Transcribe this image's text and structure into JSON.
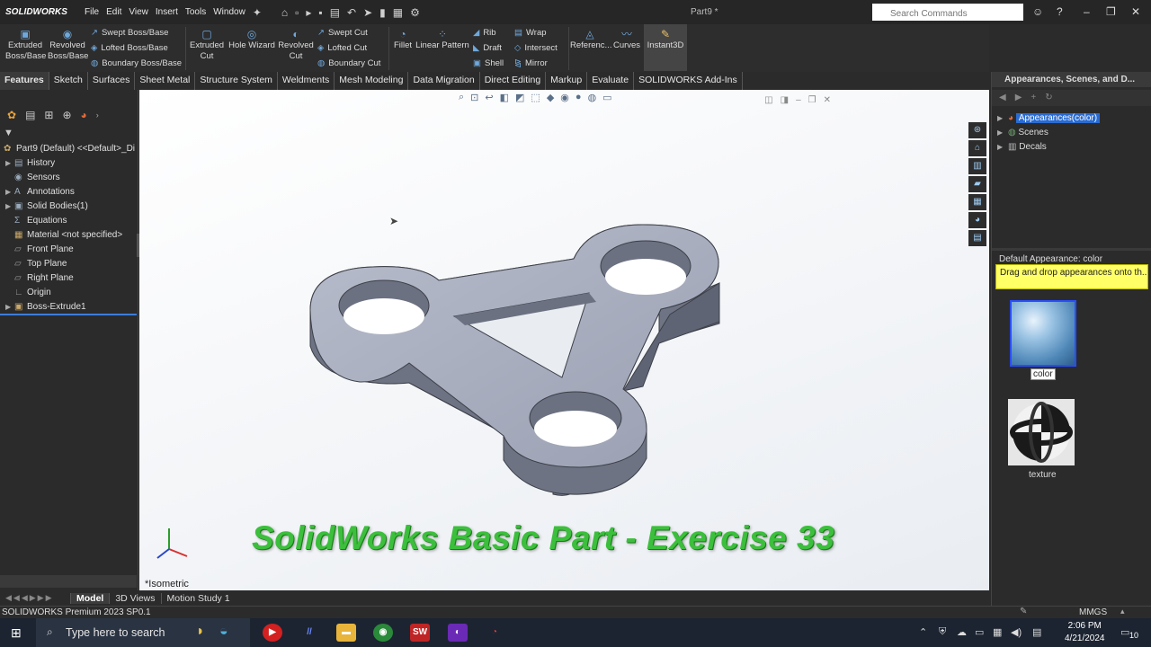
{
  "app": {
    "logo": "SOLIDWORKS",
    "document_title": "Part9 *",
    "menu": [
      "File",
      "Edit",
      "View",
      "Insert",
      "Tools",
      "Window"
    ],
    "search_placeholder": "Search Commands"
  },
  "ribbon": {
    "extruded_boss": "Extruded\nBoss/Base",
    "revolved_boss": "Revolved\nBoss/Base",
    "swept_boss": "Swept Boss/Base",
    "lofted_boss": "Lofted Boss/Base",
    "boundary_boss": "Boundary Boss/Base",
    "extruded_cut": "Extruded\nCut",
    "hole_wizard": "Hole Wizard",
    "revolved_cut": "Revolved\nCut",
    "swept_cut": "Swept Cut",
    "lofted_cut": "Lofted Cut",
    "boundary_cut": "Boundary Cut",
    "fillet": "Fillet",
    "linear_pattern": "Linear Pattern",
    "rib": "Rib",
    "draft": "Draft",
    "shell": "Shell",
    "wrap": "Wrap",
    "intersect": "Intersect",
    "mirror": "Mirror",
    "reference": "Referenc...",
    "curves": "Curves",
    "instant3d": "Instant3D"
  },
  "tabs": [
    "Features",
    "Sketch",
    "Surfaces",
    "Sheet Metal",
    "Structure System",
    "Weldments",
    "Mesh Modeling",
    "Data Migration",
    "Direct Editing",
    "Markup",
    "Evaluate",
    "SOLIDWORKS Add-Ins"
  ],
  "tree": {
    "root": "Part9 (Default) <<Default>_Di",
    "items": [
      "History",
      "Sensors",
      "Annotations",
      "Solid Bodies(1)",
      "Equations",
      "Material <not specified>",
      "Front Plane",
      "Top Plane",
      "Right Plane",
      "Origin",
      "Boss-Extrude1"
    ]
  },
  "viewport": {
    "overlay_title": "SolidWorks Basic Part - Exercise 33",
    "view_label": "*Isometric"
  },
  "bottom_tabs": [
    "Model",
    "3D Views",
    "Motion Study 1"
  ],
  "status": {
    "version": "SOLIDWORKS Premium 2023 SP0.1",
    "units": "MMGS"
  },
  "appearances_panel": {
    "header": "Appearances, Scenes, and D...",
    "tree": [
      "Appearances(color)",
      "Scenes",
      "Decals"
    ],
    "default_appearance": "Default Appearance: color",
    "tooltip": "Drag and drop appearances onto th...",
    "swatches": [
      "color",
      "texture"
    ]
  },
  "taskbar": {
    "search_text": "Type here to search",
    "time": "2:06 PM",
    "date": "4/21/2024",
    "notifications": "10"
  }
}
